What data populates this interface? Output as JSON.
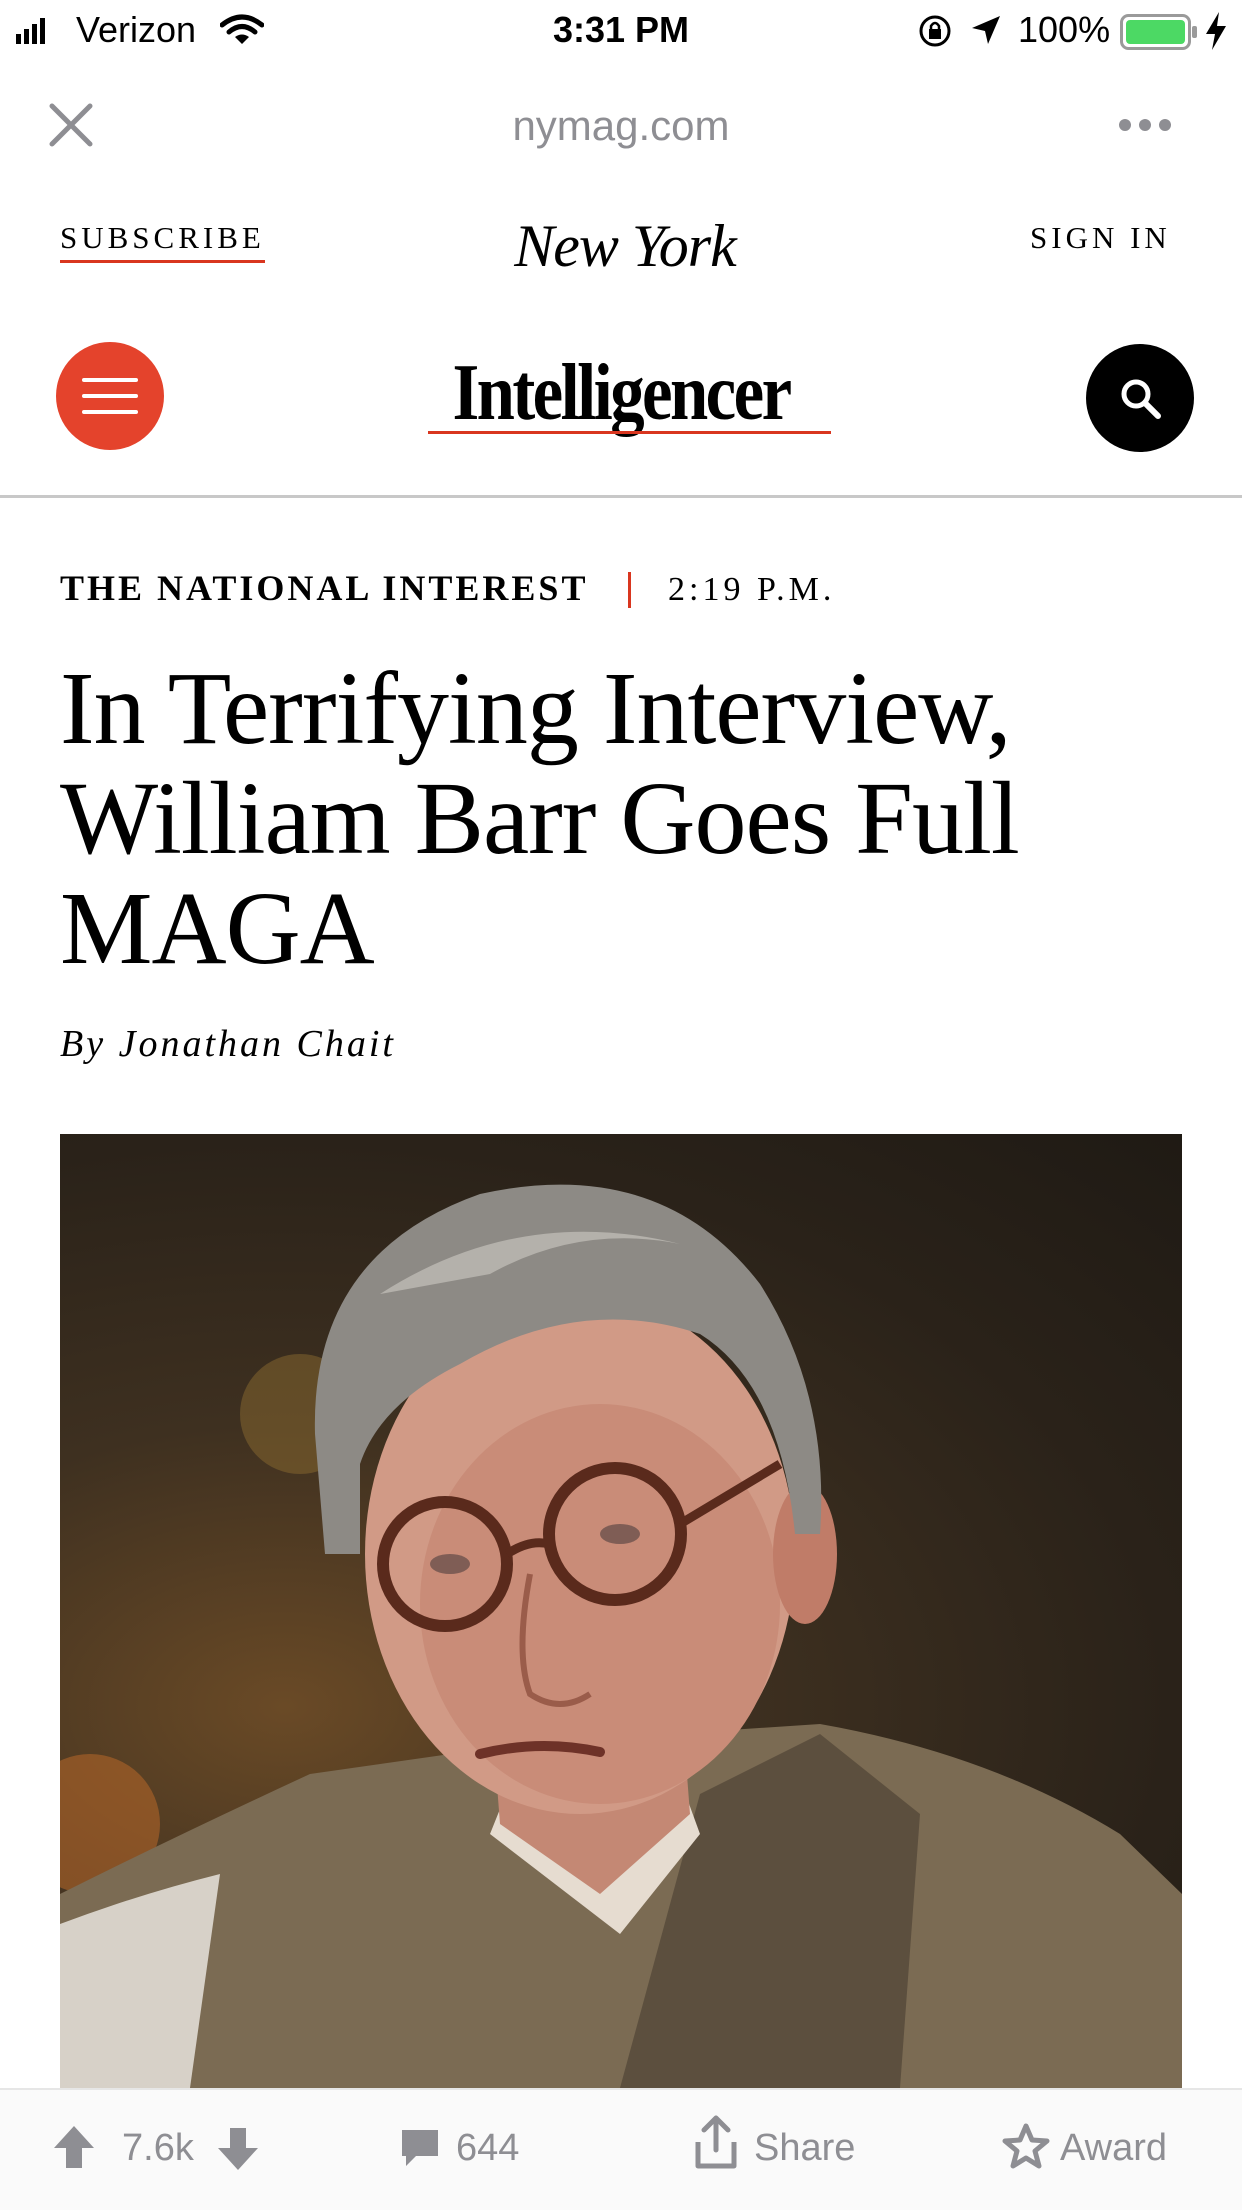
{
  "status_bar": {
    "carrier": "Verizon",
    "time": "3:31 PM",
    "battery_percent": "100%"
  },
  "browser": {
    "url": "nymag.com"
  },
  "site_header": {
    "subscribe_label": "SUBSCRIBE",
    "logo_text": "New York",
    "sign_in_label": "SIGN IN",
    "brand": "Intelligencer"
  },
  "article": {
    "rubric": "THE NATIONAL INTEREST",
    "timestamp": "2:19 P.M.",
    "headline": "In Terrifying Interview, William Barr Goes Full MAGA",
    "byline": "By Jonathan Chait"
  },
  "bottom_bar": {
    "score": "7.6k",
    "comments": "644",
    "share_label": "Share",
    "award_label": "Award"
  },
  "colors": {
    "accent_red": "#e4432c",
    "underline_red": "#d9361f",
    "battery_green": "#4cd964",
    "toolbar_gray": "#8e8e93"
  },
  "icons": [
    "signal-icon",
    "wifi-icon",
    "orientation-lock-icon",
    "location-icon",
    "battery-icon",
    "charging-icon",
    "close-icon",
    "more-icon",
    "menu-icon",
    "search-icon",
    "upvote-icon",
    "downvote-icon",
    "comment-icon",
    "share-icon",
    "award-icon"
  ]
}
